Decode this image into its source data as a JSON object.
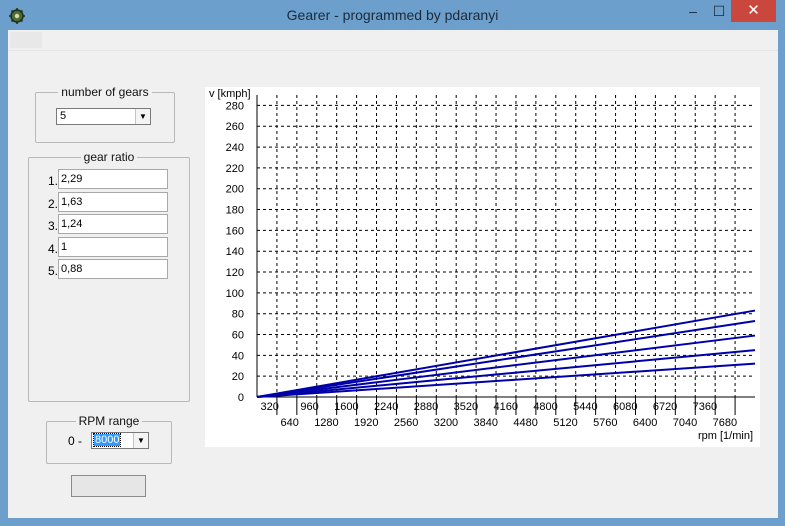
{
  "window": {
    "title": "Gearer - programmed by pdaranyi",
    "controls": {
      "minimize": "–",
      "maximize": "☐",
      "close": "✕"
    }
  },
  "gears": {
    "legend": "number of gears",
    "selected": "5"
  },
  "ratios": {
    "legend": "gear ratio",
    "items": [
      {
        "num": "1.",
        "value": "2,29"
      },
      {
        "num": "2.",
        "value": "1,63"
      },
      {
        "num": "3.",
        "value": "1,24"
      },
      {
        "num": "4.",
        "value": "1"
      },
      {
        "num": "5.",
        "value": "0,88"
      }
    ]
  },
  "rpm": {
    "legend": "RPM range",
    "prefix": "0 -",
    "selected": "8000"
  },
  "action_button": {
    "label": ""
  },
  "colors": {
    "line": "#0000a8",
    "grid": "#000000",
    "close": "#c9473d",
    "frame": "#6c9fcc"
  },
  "chart_data": {
    "type": "line",
    "xlabel": "rpm [1/min]",
    "ylabel": "v [kmph]",
    "xlim": [
      0,
      8000
    ],
    "ylim": [
      0,
      290
    ],
    "x_ticks": [
      320,
      640,
      960,
      1280,
      1600,
      1920,
      2240,
      2560,
      2880,
      3200,
      3520,
      3840,
      4160,
      4480,
      4800,
      5120,
      5440,
      5760,
      6080,
      6400,
      6720,
      7040,
      7360,
      7680
    ],
    "y_ticks": [
      0,
      20,
      40,
      60,
      80,
      100,
      120,
      140,
      160,
      180,
      200,
      220,
      240,
      260,
      280
    ],
    "grid": true,
    "series": [
      {
        "x": [
          0,
          8000
        ],
        "y": [
          0,
          32
        ]
      },
      {
        "x": [
          0,
          8000
        ],
        "y": [
          0,
          45
        ]
      },
      {
        "x": [
          0,
          8000
        ],
        "y": [
          0,
          59
        ]
      },
      {
        "x": [
          0,
          8000
        ],
        "y": [
          0,
          73
        ]
      },
      {
        "x": [
          0,
          8000
        ],
        "y": [
          0,
          83
        ]
      }
    ]
  }
}
